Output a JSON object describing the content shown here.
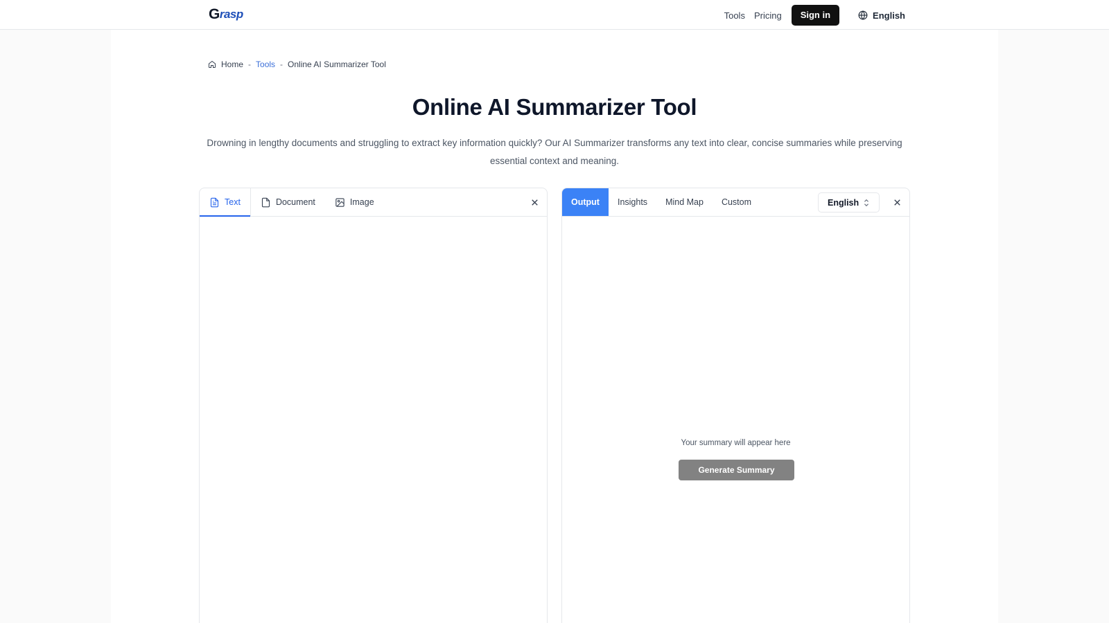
{
  "header": {
    "logo_first": "G",
    "logo_rest": "rasp",
    "nav": {
      "tools": "Tools",
      "pricing": "Pricing",
      "signin": "Sign in",
      "language": "English"
    }
  },
  "breadcrumb": {
    "home": "Home",
    "sep": "-",
    "tools": "Tools",
    "current": "Online AI Summarizer Tool"
  },
  "hero": {
    "title": "Online AI Summarizer Tool",
    "subtitle": "Drowning in lengthy documents and struggling to extract key information quickly? Our AI Summarizer transforms any text into clear, concise summaries while preserving essential context and meaning."
  },
  "input_panel": {
    "tabs": [
      "Text",
      "Document",
      "Image"
    ],
    "active_tab": "Text"
  },
  "output_panel": {
    "tabs": [
      "Output",
      "Insights",
      "Mind Map",
      "Custom"
    ],
    "active_tab": "Output",
    "language": "English",
    "empty_message": "Your summary will appear here",
    "generate_label": "Generate Summary"
  },
  "colors": {
    "accent": "#3b82f6",
    "link": "#3b6fd8",
    "signin_bg": "#111111",
    "generate_bg": "#828282"
  }
}
